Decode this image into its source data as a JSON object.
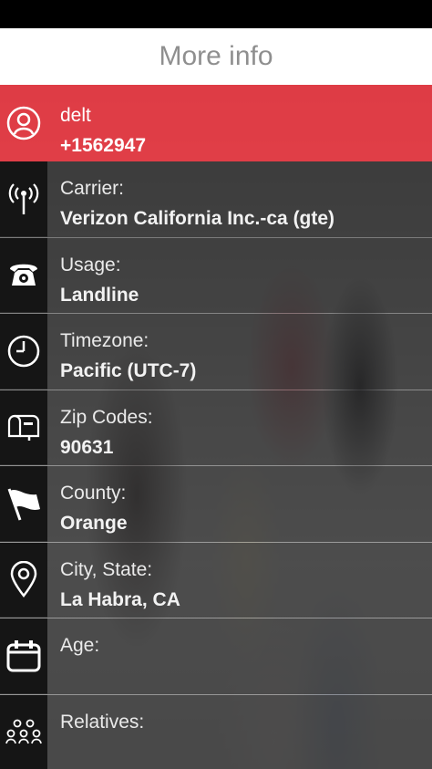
{
  "header": {
    "title": "More info"
  },
  "contact": {
    "name": "delt",
    "phone": "+1562947"
  },
  "rows": [
    {
      "label": "Carrier:",
      "value": "Verizon California Inc.-ca (gte)",
      "icon": "antenna-icon"
    },
    {
      "label": "Usage:",
      "value": "Landline",
      "icon": "telephone-icon"
    },
    {
      "label": "Timezone:",
      "value": "Pacific (UTC-7)",
      "icon": "clock-icon"
    },
    {
      "label": "Zip Codes:",
      "value": "90631",
      "icon": "mailbox-icon"
    },
    {
      "label": "County:",
      "value": "Orange",
      "icon": "flag-icon"
    },
    {
      "label": "City, State:",
      "value": "La Habra, CA",
      "icon": "location-pin-icon"
    },
    {
      "label": "Age:",
      "value": "",
      "icon": "calendar-icon"
    },
    {
      "label": "Relatives:",
      "value": "",
      "icon": "people-group-icon"
    }
  ],
  "colors": {
    "accent": "#EC2E38",
    "icon_bg": "#151515"
  }
}
